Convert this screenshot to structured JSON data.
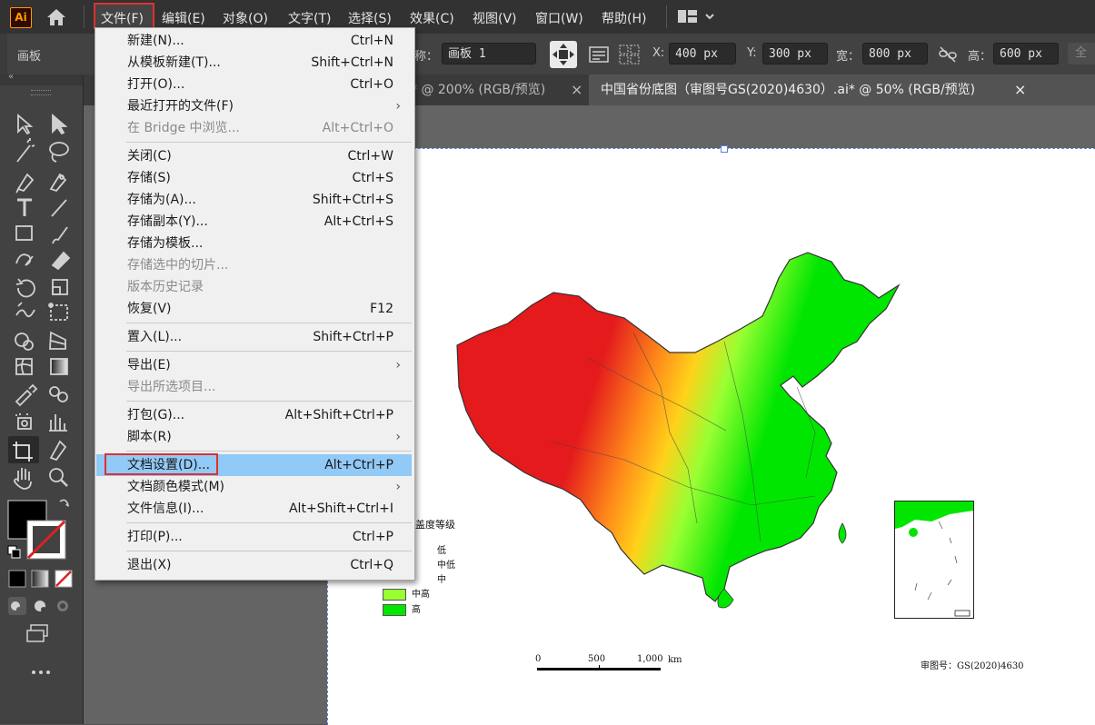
{
  "app": {
    "logo": "Ai"
  },
  "menubar": {
    "items": [
      "文件(F)",
      "编辑(E)",
      "对象(O)",
      "文字(T)",
      "选择(S)",
      "效果(C)",
      "视图(V)",
      "窗口(W)",
      "帮助(H)"
    ]
  },
  "controlbar": {
    "panel_label": "画板",
    "name_label": "称：",
    "artboard_name": "画板 1",
    "x_label": "X:",
    "x_value": "400 px",
    "y_label": "Y:",
    "y_value": "300 px",
    "w_label": "宽：",
    "w_value": "800 px",
    "h_label": "高：",
    "h_value": "600 px",
    "all_label": "全"
  },
  "tabs": [
    {
      "label": "* @ 200% (RGB/预览)",
      "close": "×"
    },
    {
      "label": "中国省份底图（审图号GS(2020)4630）.ai* @ 50% (RGB/预览)",
      "close": "×"
    }
  ],
  "file_menu": {
    "items": [
      {
        "label": "新建(N)...",
        "shortcut": "Ctrl+N"
      },
      {
        "label": "从模板新建(T)...",
        "shortcut": "Shift+Ctrl+N"
      },
      {
        "label": "打开(O)...",
        "shortcut": "Ctrl+O"
      },
      {
        "label": "最近打开的文件(F)",
        "shortcut": ""
      },
      {
        "label": "在 Bridge 中浏览...",
        "shortcut": "Alt+Ctrl+O"
      },
      {
        "label": "关闭(C)",
        "shortcut": "Ctrl+W"
      },
      {
        "label": "存储(S)",
        "shortcut": "Ctrl+S"
      },
      {
        "label": "存储为(A)...",
        "shortcut": "Shift+Ctrl+S"
      },
      {
        "label": "存储副本(Y)...",
        "shortcut": "Alt+Ctrl+S"
      },
      {
        "label": "存储为模板...",
        "shortcut": ""
      },
      {
        "label": "存储选中的切片...",
        "shortcut": ""
      },
      {
        "label": "版本历史记录",
        "shortcut": ""
      },
      {
        "label": "恢复(V)",
        "shortcut": "F12"
      },
      {
        "label": "置入(L)...",
        "shortcut": "Shift+Ctrl+P"
      },
      {
        "label": "导出(E)",
        "shortcut": ""
      },
      {
        "label": "导出所选项目...",
        "shortcut": ""
      },
      {
        "label": "打包(G)...",
        "shortcut": "Alt+Shift+Ctrl+P"
      },
      {
        "label": "脚本(R)",
        "shortcut": ""
      },
      {
        "label": "文档设置(D)...",
        "shortcut": "Alt+Ctrl+P"
      },
      {
        "label": "文档颜色模式(M)",
        "shortcut": ""
      },
      {
        "label": "文件信息(I)...",
        "shortcut": "Alt+Shift+Ctrl+I"
      },
      {
        "label": "打印(P)...",
        "shortcut": "Ctrl+P"
      },
      {
        "label": "退出(X)",
        "shortcut": "Ctrl+Q"
      }
    ]
  },
  "map": {
    "legend_title": "盖度等级",
    "legend": [
      {
        "label": "低",
        "color": "#e41a1c"
      },
      {
        "label": "中低",
        "color": "#ff8c1a"
      },
      {
        "label": "中",
        "color": "#ffff33"
      },
      {
        "label": "中高",
        "color": "#99ff33"
      },
      {
        "label": "高",
        "color": "#00e600"
      }
    ],
    "scale_ticks": [
      "0",
      "500",
      "1,000"
    ],
    "scale_unit": "km",
    "approval_no": "审图号：GS(2020)4630"
  },
  "colors": {
    "accent_red": "#e03030",
    "highlight_blue": "#91c9f7"
  }
}
